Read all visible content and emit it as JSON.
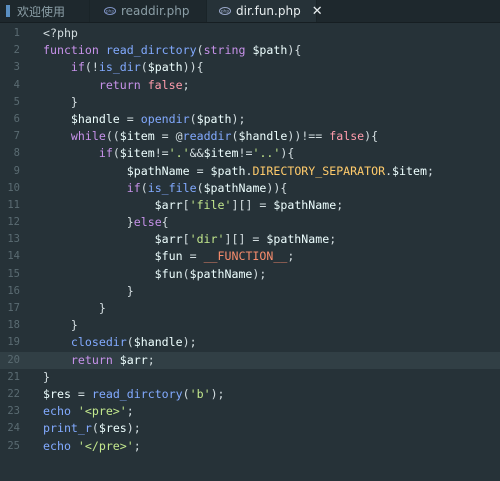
{
  "tabs": [
    {
      "label": "欢迎使用",
      "active": false
    },
    {
      "label": "readdir.php",
      "active": false
    },
    {
      "label": "dir.fun.php",
      "active": true
    }
  ],
  "close_glyph": "✕",
  "current_line": 20,
  "lines": [
    {
      "n": "1",
      "tokens": [
        {
          "t": "<?php",
          "c": "tg"
        }
      ]
    },
    {
      "n": "2",
      "tokens": [
        {
          "t": "function ",
          "c": "kw"
        },
        {
          "t": "read_dirctory",
          "c": "fn"
        },
        {
          "t": "(",
          "c": "pu"
        },
        {
          "t": "string ",
          "c": "kw"
        },
        {
          "t": "$path",
          "c": "vr"
        },
        {
          "t": "){",
          "c": "pu"
        }
      ]
    },
    {
      "n": "3",
      "tokens": [
        {
          "t": "    if",
          "c": "kw"
        },
        {
          "t": "(!",
          "c": "pu"
        },
        {
          "t": "is_dir",
          "c": "fn"
        },
        {
          "t": "(",
          "c": "pu"
        },
        {
          "t": "$path",
          "c": "vr"
        },
        {
          "t": ")){",
          "c": "pu"
        }
      ]
    },
    {
      "n": "4",
      "tokens": [
        {
          "t": "        return ",
          "c": "kw"
        },
        {
          "t": "false",
          "c": "bo"
        },
        {
          "t": ";",
          "c": "pu"
        }
      ]
    },
    {
      "n": "5",
      "tokens": [
        {
          "t": "    }",
          "c": "pu"
        }
      ]
    },
    {
      "n": "6",
      "tokens": [
        {
          "t": "    $handle",
          "c": "vr"
        },
        {
          "t": " = ",
          "c": "pu"
        },
        {
          "t": "opendir",
          "c": "fn"
        },
        {
          "t": "(",
          "c": "pu"
        },
        {
          "t": "$path",
          "c": "vr"
        },
        {
          "t": ");",
          "c": "pu"
        }
      ]
    },
    {
      "n": "7",
      "tokens": [
        {
          "t": "    while",
          "c": "kw"
        },
        {
          "t": "((",
          "c": "pu"
        },
        {
          "t": "$item",
          "c": "vr"
        },
        {
          "t": " = @",
          "c": "pu"
        },
        {
          "t": "readdir",
          "c": "fn"
        },
        {
          "t": "(",
          "c": "pu"
        },
        {
          "t": "$handle",
          "c": "vr"
        },
        {
          "t": "))!== ",
          "c": "pu"
        },
        {
          "t": "false",
          "c": "bo"
        },
        {
          "t": "){",
          "c": "pu"
        }
      ]
    },
    {
      "n": "8",
      "tokens": [
        {
          "t": "        if",
          "c": "kw"
        },
        {
          "t": "(",
          "c": "pu"
        },
        {
          "t": "$item",
          "c": "vr"
        },
        {
          "t": "!=",
          "c": "pu"
        },
        {
          "t": "'.'",
          "c": "st"
        },
        {
          "t": "&&",
          "c": "pu"
        },
        {
          "t": "$item",
          "c": "vr"
        },
        {
          "t": "!=",
          "c": "pu"
        },
        {
          "t": "'..'",
          "c": "st"
        },
        {
          "t": "){",
          "c": "pu"
        }
      ]
    },
    {
      "n": "9",
      "tokens": [
        {
          "t": "            $pathName",
          "c": "vr"
        },
        {
          "t": " = ",
          "c": "pu"
        },
        {
          "t": "$path",
          "c": "vr"
        },
        {
          "t": ".",
          "c": "pu"
        },
        {
          "t": "DIRECTORY_SEPARATOR",
          "c": "cn"
        },
        {
          "t": ".",
          "c": "pu"
        },
        {
          "t": "$item",
          "c": "vr"
        },
        {
          "t": ";",
          "c": "pu"
        }
      ]
    },
    {
      "n": "10",
      "tokens": [
        {
          "t": "            if",
          "c": "kw"
        },
        {
          "t": "(",
          "c": "pu"
        },
        {
          "t": "is_file",
          "c": "fn"
        },
        {
          "t": "(",
          "c": "pu"
        },
        {
          "t": "$pathName",
          "c": "vr"
        },
        {
          "t": ")){",
          "c": "pu"
        }
      ]
    },
    {
      "n": "11",
      "tokens": [
        {
          "t": "                $arr",
          "c": "vr"
        },
        {
          "t": "[",
          "c": "pu"
        },
        {
          "t": "'file'",
          "c": "st"
        },
        {
          "t": "][] = ",
          "c": "pu"
        },
        {
          "t": "$pathName",
          "c": "vr"
        },
        {
          "t": ";",
          "c": "pu"
        }
      ]
    },
    {
      "n": "12",
      "tokens": [
        {
          "t": "            }",
          "c": "pu"
        },
        {
          "t": "else",
          "c": "kw"
        },
        {
          "t": "{",
          "c": "pu"
        }
      ]
    },
    {
      "n": "13",
      "tokens": [
        {
          "t": "                $arr",
          "c": "vr"
        },
        {
          "t": "[",
          "c": "pu"
        },
        {
          "t": "'dir'",
          "c": "st"
        },
        {
          "t": "][] = ",
          "c": "pu"
        },
        {
          "t": "$pathName",
          "c": "vr"
        },
        {
          "t": ";",
          "c": "pu"
        }
      ]
    },
    {
      "n": "14",
      "tokens": [
        {
          "t": "                $fun",
          "c": "vr"
        },
        {
          "t": " = ",
          "c": "pu"
        },
        {
          "t": "__FUNCTION__",
          "c": "ct"
        },
        {
          "t": ";",
          "c": "pu"
        }
      ]
    },
    {
      "n": "15",
      "tokens": [
        {
          "t": "                $fun",
          "c": "vr"
        },
        {
          "t": "(",
          "c": "pu"
        },
        {
          "t": "$pathName",
          "c": "vr"
        },
        {
          "t": ");",
          "c": "pu"
        }
      ]
    },
    {
      "n": "16",
      "tokens": [
        {
          "t": "            }",
          "c": "pu"
        }
      ]
    },
    {
      "n": "17",
      "tokens": [
        {
          "t": "        }",
          "c": "pu"
        }
      ]
    },
    {
      "n": "18",
      "tokens": [
        {
          "t": "    }",
          "c": "pu"
        }
      ]
    },
    {
      "n": "19",
      "tokens": [
        {
          "t": "    closedir",
          "c": "fn"
        },
        {
          "t": "(",
          "c": "pu"
        },
        {
          "t": "$handle",
          "c": "vr"
        },
        {
          "t": ");",
          "c": "pu"
        }
      ]
    },
    {
      "n": "20",
      "tokens": [
        {
          "t": "    return ",
          "c": "kw"
        },
        {
          "t": "$arr",
          "c": "vr"
        },
        {
          "t": ";",
          "c": "pu"
        }
      ]
    },
    {
      "n": "21",
      "tokens": [
        {
          "t": "}",
          "c": "pu"
        }
      ]
    },
    {
      "n": "22",
      "tokens": [
        {
          "t": "$res",
          "c": "vr"
        },
        {
          "t": " = ",
          "c": "pu"
        },
        {
          "t": "read_dirctory",
          "c": "fn"
        },
        {
          "t": "(",
          "c": "pu"
        },
        {
          "t": "'b'",
          "c": "st"
        },
        {
          "t": ");",
          "c": "pu"
        }
      ]
    },
    {
      "n": "23",
      "tokens": [
        {
          "t": "echo ",
          "c": "fn"
        },
        {
          "t": "'<pre>'",
          "c": "st"
        },
        {
          "t": ";",
          "c": "pu"
        }
      ]
    },
    {
      "n": "24",
      "tokens": [
        {
          "t": "print_r",
          "c": "fn"
        },
        {
          "t": "(",
          "c": "pu"
        },
        {
          "t": "$res",
          "c": "vr"
        },
        {
          "t": ");",
          "c": "pu"
        }
      ]
    },
    {
      "n": "25",
      "tokens": [
        {
          "t": "echo ",
          "c": "fn"
        },
        {
          "t": "'</pre>'",
          "c": "st"
        },
        {
          "t": ";",
          "c": "pu"
        }
      ]
    }
  ]
}
